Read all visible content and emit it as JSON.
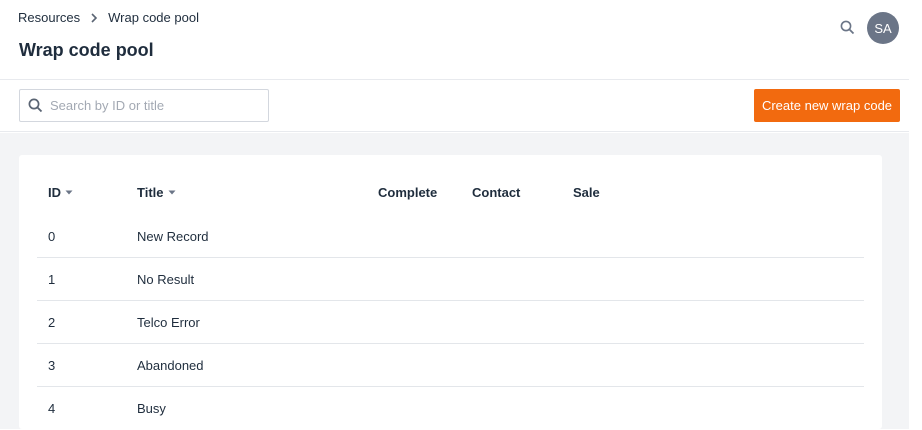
{
  "breadcrumb": {
    "parent": "Resources",
    "current": "Wrap code pool"
  },
  "page_title": "Wrap code pool",
  "user": {
    "initials": "SA"
  },
  "search": {
    "placeholder": "Search by ID or title",
    "value": ""
  },
  "actions": {
    "create_label": "Create new wrap code"
  },
  "table": {
    "columns": [
      {
        "label": "ID",
        "sortable": true
      },
      {
        "label": "Title",
        "sortable": true
      },
      {
        "label": "Complete",
        "sortable": false
      },
      {
        "label": "Contact",
        "sortable": false
      },
      {
        "label": "Sale",
        "sortable": false
      }
    ],
    "rows": [
      {
        "id": "0",
        "title": "New Record",
        "complete": "",
        "contact": "",
        "sale": ""
      },
      {
        "id": "1",
        "title": "No Result",
        "complete": "",
        "contact": "",
        "sale": ""
      },
      {
        "id": "2",
        "title": "Telco Error",
        "complete": "",
        "contact": "",
        "sale": ""
      },
      {
        "id": "3",
        "title": "Abandoned",
        "complete": "",
        "contact": "",
        "sale": ""
      },
      {
        "id": "4",
        "title": "Busy",
        "complete": "",
        "contact": "",
        "sale": ""
      }
    ]
  },
  "colors": {
    "accent": "#f26a0f",
    "avatar": "#6b7587",
    "text": "#1f2d3d",
    "page_bg": "#f3f4f6"
  },
  "icons": {
    "header_search": "search-icon",
    "breadcrumb_separator": "chevron-right-icon",
    "field_search": "search-icon",
    "sort": "caret-down-icon"
  }
}
